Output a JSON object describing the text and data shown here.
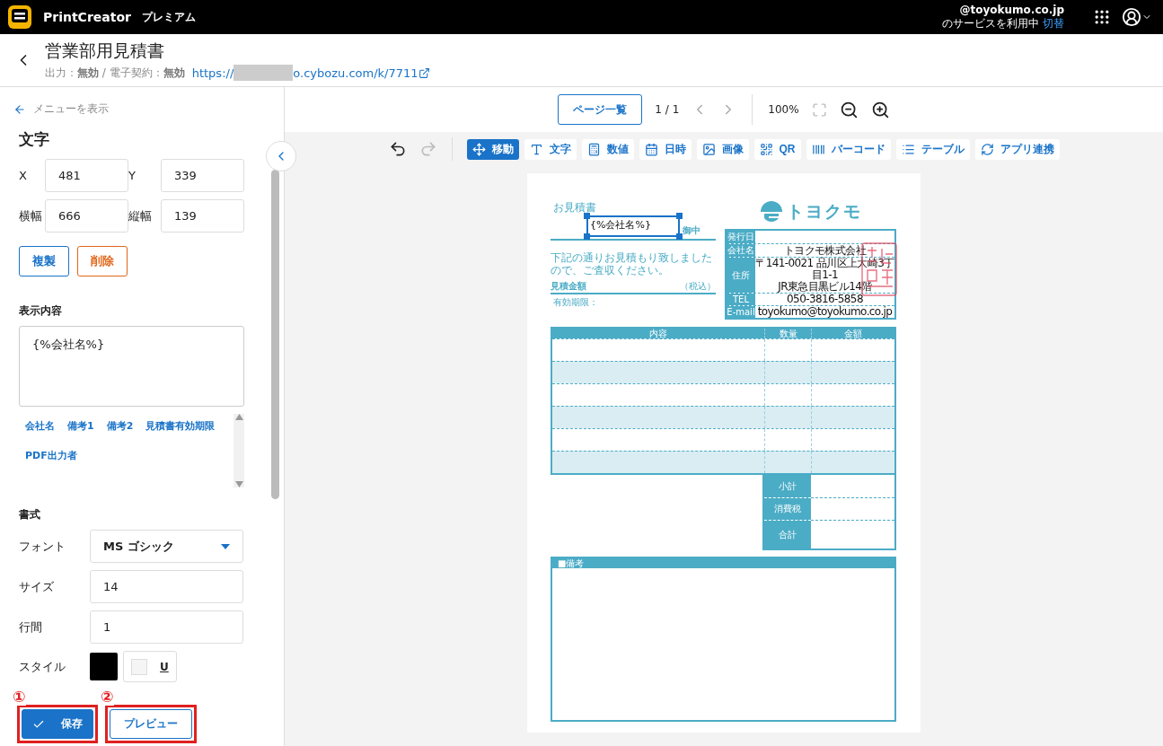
{
  "app": {
    "name": "PrintCreator",
    "plan": "プレミアム"
  },
  "account": {
    "domain": "@toyokumo.co.jp",
    "service_text": "のサービスを利用中",
    "switch_link": "切替"
  },
  "document": {
    "title": "営業部用見積書",
    "status": "出力：**無効** / 電子契約：**無効**",
    "url_prefix": "https://",
    "url_suffix": "o.cybozu.com/k/7711"
  },
  "sidebar": {
    "back_link": "メニューを表示",
    "section_title": "文字",
    "position": [
      {
        "label": "X",
        "value": "481"
      },
      {
        "label": "Y",
        "value": "339"
      },
      {
        "label": "横幅",
        "value": "666"
      },
      {
        "label": "縦幅",
        "value": "139"
      }
    ],
    "buttons": [
      {
        "label": "複製",
        "kind": "primary"
      },
      {
        "label": "削除",
        "kind": "danger"
      }
    ],
    "content_label": "表示内容",
    "content_value": "{%会社名%}",
    "field_chips": [
      "会社名",
      "備考1",
      "備考2",
      "見積書有効期限",
      "PDF出力者"
    ],
    "format_label": "書式",
    "format_rows": [
      {
        "label": "フォント",
        "kind": "select",
        "value": "MS ゴシック"
      },
      {
        "label": "サイズ",
        "kind": "input",
        "value": "14"
      },
      {
        "label": "行間",
        "kind": "input",
        "value": "1"
      }
    ],
    "style": {
      "label": "スタイル",
      "color": "#000000",
      "underline": {
        "label": "U",
        "checked": false
      }
    },
    "actions": [
      {
        "label": "保存",
        "kind": "save",
        "annotation": "①"
      },
      {
        "label": "プレビュー",
        "kind": "preview",
        "annotation": "②"
      }
    ]
  },
  "viewer": {
    "page_list_button": "ページ一覧",
    "page_indicator": "1 / 1",
    "zoom": "100%"
  },
  "tools": [
    {
      "label": "移動",
      "selected": true
    },
    {
      "label": "文字",
      "selected": false
    },
    {
      "label": "数値",
      "selected": false
    },
    {
      "label": "日時",
      "selected": false
    },
    {
      "label": "画像",
      "selected": false
    },
    {
      "label": "QR",
      "selected": false
    },
    {
      "label": "バーコード",
      "selected": false
    },
    {
      "label": "テーブル",
      "selected": false
    },
    {
      "label": "アプリ連携",
      "selected": false
    }
  ],
  "template": {
    "title": "お見積書",
    "name_field": "{%会社名%}",
    "honorific": "御中",
    "brand": "トヨクモ",
    "info_rows": [
      {
        "label": "発行日"
      },
      {
        "label": "会社名",
        "lines": [
          "トヨクモ株式会社"
        ]
      },
      {
        "label": "住所",
        "lines": [
          "〒141-0021 品川区上大崎3丁目1-1",
          "JR東急目黒ビル14階"
        ]
      },
      {
        "label": "TEL",
        "lines": [
          "050-3816-5858"
        ]
      },
      {
        "label": "E-mail",
        "lines": [
          "toyokumo@toyokumo.co.jp"
        ]
      }
    ],
    "note": "下記の通りお見積もり致しましたので、ご査収ください。",
    "amount_label": "見積金額",
    "tax_note": "（税込）",
    "validity_label": "有効期限：",
    "columns": [
      "内容",
      "数量",
      "金額"
    ],
    "rows": [
      {
        "shaded": false
      },
      {
        "shaded": true
      },
      {
        "shaded": false
      },
      {
        "shaded": true
      },
      {
        "shaded": false
      },
      {
        "shaded": true
      }
    ],
    "totals": [
      "小計",
      "消費税",
      "合計"
    ],
    "remarks_label": "■備考"
  }
}
